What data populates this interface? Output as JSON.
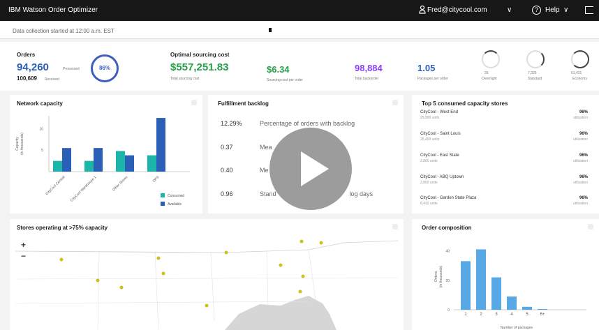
{
  "topbar": {
    "app_title": "IBM Watson Order Optimizer",
    "user": "Fred@citycool.com",
    "user_chevron": "∨",
    "help_label": "Help",
    "help_chevron": "∨",
    "help_glyph": "?"
  },
  "status": {
    "text": "Data collection started at 12:00 a.m. EST"
  },
  "kpis": {
    "orders": {
      "label": "Orders",
      "processed": "94,260",
      "processed_label": "Processed",
      "received": "100,609",
      "received_label": "Received",
      "ring_text": "86%",
      "ring_color": "#3f5fbf"
    },
    "cost": {
      "label": "Optimal sourcing cost",
      "total": "$557,251.83",
      "total_label": "Total sourcing cost",
      "per_order": "$6.34",
      "per_order_label": "Sourcing cost per order",
      "per_order_color": "#24a148",
      "total_color": "#24a148",
      "backorder": "98,884",
      "backorder_label": "Total backorder",
      "backorder_color": "#8a3ffc",
      "packages": "1.05",
      "packages_label": "Packages per order"
    },
    "rings": [
      {
        "value": "25",
        "label": "Overnight"
      },
      {
        "value": "7,325",
        "label": "Standard"
      },
      {
        "value": "61,421",
        "label": "Economy"
      }
    ]
  },
  "network": {
    "title": "Network capacity",
    "ylabel": "Capacity",
    "ylabel2": "(in thousands)",
    "legend": [
      {
        "label": "Consumed",
        "color": "#1ab5a8"
      },
      {
        "label": "Available",
        "color": "#2a5fb8"
      }
    ]
  },
  "chart_data": [
    {
      "type": "bar",
      "title": "Network capacity",
      "ylabel": "Capacity (in thousands)",
      "categories": [
        "CityCool Central",
        "CityCool Warehouse 1",
        "Other Stores",
        "DPS"
      ],
      "series": [
        {
          "name": "Consumed",
          "values": [
            2.5,
            2.5,
            4.8,
            3.8
          ]
        },
        {
          "name": "Available",
          "values": [
            5.5,
            5.5,
            3.8,
            12.5
          ]
        }
      ],
      "yticks": [
        5,
        10
      ],
      "ylim": [
        0,
        13
      ]
    },
    {
      "type": "bar",
      "title": "Order composition",
      "ylabel": "Orders (in thousands)",
      "xlabel": "Number of packages",
      "categories": [
        "1",
        "2",
        "3",
        "4",
        "5",
        "6+"
      ],
      "values": [
        33,
        41,
        22,
        9,
        2,
        0.5
      ],
      "yticks": [
        0,
        20,
        40
      ],
      "ylim": [
        0,
        45
      ]
    }
  ],
  "network_categories": [
    "CityCool Central",
    "CityCool Warehouse 1",
    "Other Stores",
    "DPS"
  ],
  "network_yticks": [
    "10",
    "5"
  ],
  "backlog": {
    "title": "Fulfillment backlog",
    "rows": [
      {
        "value": "12.29%",
        "text": "Percentage of orders with backlog"
      },
      {
        "value": "0.37",
        "text": "Mea"
      },
      {
        "value": "0.40",
        "text": "Me"
      },
      {
        "value": "0.96",
        "text": "Stand                                          log days"
      }
    ]
  },
  "top_stores": {
    "title": "Top 5 consumed capacity stores",
    "stores": [
      {
        "name": "CityCool - West End",
        "units": "25,800 units",
        "pct": "96%",
        "pct_label": "utilization"
      },
      {
        "name": "CityCool - Saint Louis",
        "units": "25,400 units",
        "pct": "96%",
        "pct_label": "utilization"
      },
      {
        "name": "CityCool - East State",
        "units": "2,860 units",
        "pct": "96%",
        "pct_label": "utilization"
      },
      {
        "name": "CityCool - ABQ Uptown",
        "units": "2,860 units",
        "pct": "96%",
        "pct_label": "utilization"
      },
      {
        "name": "CityCool - Garden State Plaza",
        "units": "8,432 units",
        "pct": "96%",
        "pct_label": "utilization"
      }
    ]
  },
  "stores_map": {
    "title": "Stores operating at >75% capacity",
    "zoom_in": "+",
    "zoom_out": "−",
    "marker_color": "#c9c220"
  },
  "order_comp": {
    "title": "Order composition",
    "ylabel": "Orders",
    "ylabel2": "(in thousands)",
    "xlabel": "Number of packages",
    "bar_color": "#59a8e6"
  }
}
